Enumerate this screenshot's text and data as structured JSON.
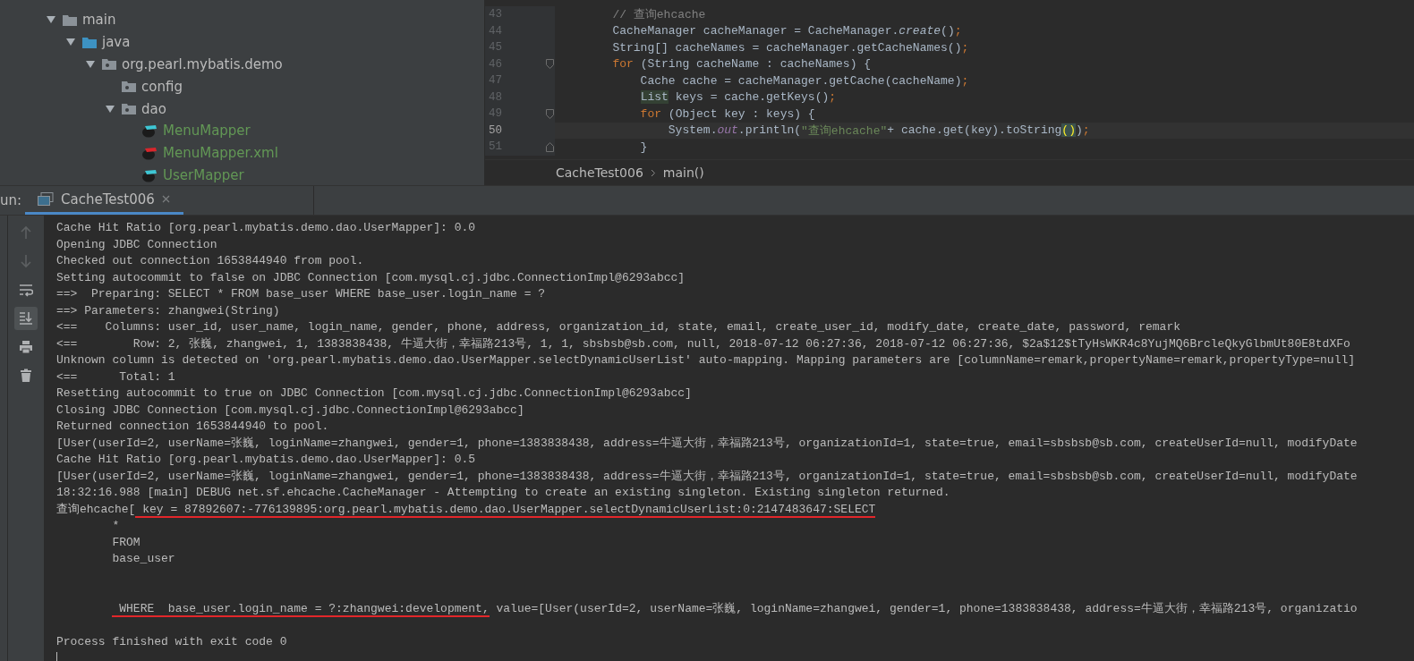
{
  "project_tree": [
    {
      "label": "main",
      "kind": "folder",
      "expanded": true,
      "added": false,
      "children": [
        {
          "label": "java",
          "kind": "source-folder",
          "expanded": true,
          "added": false,
          "children": [
            {
              "label": "org.pearl.mybatis.demo",
              "kind": "package",
              "expanded": true,
              "added": false,
              "children": [
                {
                  "label": "config",
                  "kind": "package",
                  "added": false
                },
                {
                  "label": "dao",
                  "kind": "package",
                  "expanded": true,
                  "added": false,
                  "children": [
                    {
                      "label": "MenuMapper",
                      "kind": "mapper",
                      "added": true
                    },
                    {
                      "label": "MenuMapper.xml",
                      "kind": "mapper-xml",
                      "added": true
                    },
                    {
                      "label": "UserMapper",
                      "kind": "mapper",
                      "added": true
                    }
                  ]
                }
              ]
            }
          ]
        }
      ]
    }
  ],
  "editor": {
    "lines": [
      {
        "number": "43",
        "fold_start": false,
        "fold_end": false,
        "current": false,
        "tokens": [
          {
            "kind": "comment",
            "text": "        // 查询ehcache"
          }
        ]
      },
      {
        "number": "44",
        "fold_start": false,
        "fold_end": false,
        "current": false,
        "tokens": [
          {
            "kind": "plain",
            "text": "        CacheManager cacheManager = CacheManager."
          },
          {
            "kind": "static",
            "text": "create"
          },
          {
            "kind": "plain",
            "text": "()"
          },
          {
            "kind": "keyword",
            "text": ";"
          }
        ]
      },
      {
        "number": "45",
        "fold_start": false,
        "fold_end": false,
        "current": false,
        "tokens": [
          {
            "kind": "plain",
            "text": "        String[] cacheNames = cacheManager.getCacheNames()"
          },
          {
            "kind": "keyword",
            "text": ";"
          }
        ]
      },
      {
        "number": "46",
        "fold_start": true,
        "fold_end": false,
        "current": false,
        "tokens": [
          {
            "kind": "keyword",
            "text": "        for"
          },
          {
            "kind": "plain",
            "text": " (String cacheName : cacheNames) {"
          }
        ]
      },
      {
        "number": "47",
        "fold_start": false,
        "fold_end": false,
        "current": false,
        "tokens": [
          {
            "kind": "plain",
            "text": "            Cache cache = cacheManager.getCache(cacheName)"
          },
          {
            "kind": "keyword",
            "text": ";"
          }
        ]
      },
      {
        "number": "48",
        "fold_start": false,
        "fold_end": false,
        "current": false,
        "tokens": [
          {
            "kind": "usage",
            "text": "            List"
          },
          {
            "kind": "plain",
            "text": " keys = cache.getKeys()"
          },
          {
            "kind": "keyword",
            "text": ";"
          }
        ]
      },
      {
        "number": "49",
        "fold_start": true,
        "fold_end": false,
        "current": false,
        "tokens": [
          {
            "kind": "keyword",
            "text": "            for"
          },
          {
            "kind": "plain",
            "text": " (Object key : keys) {"
          }
        ]
      },
      {
        "number": "50",
        "fold_start": false,
        "fold_end": false,
        "current": true,
        "tokens": [
          {
            "kind": "plain",
            "text": "                System."
          },
          {
            "kind": "field",
            "text": "out"
          },
          {
            "kind": "plain",
            "text": ".println("
          },
          {
            "kind": "string",
            "text": "\"查询ehcache\""
          },
          {
            "kind": "plain",
            "text": "+ cache.get(key).toString"
          },
          {
            "kind": "match",
            "text": "()"
          },
          {
            "kind": "plain",
            "text": ")"
          },
          {
            "kind": "keyword",
            "text": ";"
          }
        ]
      },
      {
        "number": "51",
        "fold_start": false,
        "fold_end": true,
        "current": false,
        "tokens": [
          {
            "kind": "plain",
            "text": "            }"
          }
        ]
      }
    ]
  },
  "breadcrumb": [
    "CacheTest006",
    "main()"
  ],
  "run_panel": {
    "label": "un:",
    "tabs": [
      {
        "label": "CacheTest006",
        "selected": true
      }
    ],
    "toolbar": [
      {
        "kind": "up",
        "disabled": true,
        "selected": false
      },
      {
        "kind": "down",
        "disabled": true,
        "selected": false
      },
      {
        "kind": "wrap",
        "disabled": false,
        "selected": false
      },
      {
        "kind": "scroll-end",
        "disabled": false,
        "selected": true
      },
      {
        "kind": "print",
        "disabled": false,
        "selected": false
      },
      {
        "kind": "trash",
        "disabled": false,
        "selected": false
      }
    ],
    "console": [
      {
        "kind": "text",
        "text": "Cache Hit Ratio [org.pearl.mybatis.demo.dao.UserMapper]: 0.0"
      },
      {
        "kind": "text",
        "text": "Opening JDBC Connection"
      },
      {
        "kind": "text",
        "text": "Checked out connection 1653844940 from pool."
      },
      {
        "kind": "text",
        "text": "Setting autocommit to false on JDBC Connection [com.mysql.cj.jdbc.ConnectionImpl@6293abcc]"
      },
      {
        "kind": "text",
        "text": "==>  Preparing: SELECT * FROM base_user WHERE base_user.login_name = ?"
      },
      {
        "kind": "text",
        "text": "==> Parameters: zhangwei(String)"
      },
      {
        "kind": "text",
        "text": "<==    Columns: user_id, user_name, login_name, gender, phone, address, organization_id, state, email, create_user_id, modify_date, create_date, password, remark"
      },
      {
        "kind": "text",
        "text": "<==        Row: 2, 张巍, zhangwei, 1, 1383838438, 牛逼大街，幸福路213号, 1, 1, sbsbsb@sb.com, null, 2018-07-12 06:27:36, 2018-07-12 06:27:36, $2a$12$tTyHsWKR4c8YujMQ6BrcleQkyGlbmUt80E8tdXFo"
      },
      {
        "kind": "text",
        "text": "Unknown column is detected on 'org.pearl.mybatis.demo.dao.UserMapper.selectDynamicUserList' auto-mapping. Mapping parameters are [columnName=remark,propertyName=remark,propertyType=null]"
      },
      {
        "kind": "text",
        "text": "<==      Total: 1"
      },
      {
        "kind": "text",
        "text": "Resetting autocommit to true on JDBC Connection [com.mysql.cj.jdbc.ConnectionImpl@6293abcc]"
      },
      {
        "kind": "text",
        "text": "Closing JDBC Connection [com.mysql.cj.jdbc.ConnectionImpl@6293abcc]"
      },
      {
        "kind": "text",
        "text": "Returned connection 1653844940 to pool."
      },
      {
        "kind": "text",
        "text": "[User(userId=2, userName=张巍, loginName=zhangwei, gender=1, phone=1383838438, address=牛逼大街，幸福路213号, organizationId=1, state=true, email=sbsbsb@sb.com, createUserId=null, modifyDate"
      },
      {
        "kind": "text",
        "text": "Cache Hit Ratio [org.pearl.mybatis.demo.dao.UserMapper]: 0.5"
      },
      {
        "kind": "text",
        "text": "[User(userId=2, userName=张巍, loginName=zhangwei, gender=1, phone=1383838438, address=牛逼大街，幸福路213号, organizationId=1, state=true, email=sbsbsb@sb.com, createUserId=null, modifyDate"
      },
      {
        "kind": "text",
        "text": "18:32:16.988 [main] DEBUG net.sf.ehcache.CacheManager - Attempting to create an existing singleton. Existing singleton returned."
      },
      {
        "kind": "segments",
        "segments": [
          {
            "text": "查询ehcache[",
            "marked": false
          },
          {
            "text": " key = 87892607:-776139895:org.pearl.mybatis.demo.dao.UserMapper.selectDynamicUserList:0:2147483647:SELECT",
            "marked": true
          }
        ]
      },
      {
        "kind": "text",
        "text": "        *"
      },
      {
        "kind": "text",
        "text": "        FROM"
      },
      {
        "kind": "text",
        "text": "        base_user"
      },
      {
        "kind": "blank"
      },
      {
        "kind": "blank"
      },
      {
        "kind": "segments",
        "segments": [
          {
            "text": "         WHERE  base_user.login_name = ?:zhangwei:development,",
            "marked": true
          },
          {
            "text": " value=[User(userId=2, userName=张巍, loginName=zhangwei, gender=1, phone=1383838438, address=牛逼大街，幸福路213号, organizatio",
            "marked": false
          }
        ]
      },
      {
        "kind": "blank"
      },
      {
        "kind": "text",
        "text": "Process finished with exit code 0"
      },
      {
        "kind": "cursor"
      }
    ]
  }
}
